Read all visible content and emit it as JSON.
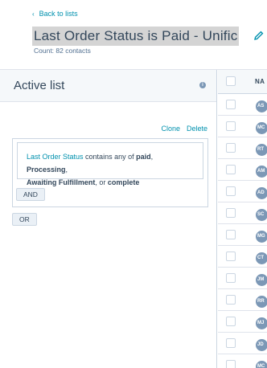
{
  "header": {
    "back_label": "Back to lists",
    "title": "Last Order Status is Paid - Unific",
    "count": "Count: 82 contacts"
  },
  "panel": {
    "title": "Active list",
    "clone_label": "Clone",
    "delete_label": "Delete",
    "filter": {
      "property": "Last Order Status",
      "operator": " contains any of ",
      "value1": "paid",
      "sep1": ", ",
      "value2": "Processing",
      "sep2": ",",
      "value3": "Awaiting Fulfillment",
      "sep3": ", or ",
      "value4": "complete"
    },
    "and_label": "AND",
    "or_label": "OR"
  },
  "table": {
    "name_header": "NA",
    "rows": [
      {
        "initials": "AS"
      },
      {
        "initials": "MC"
      },
      {
        "initials": "RT"
      },
      {
        "initials": "AM"
      },
      {
        "initials": "AD"
      },
      {
        "initials": "SC"
      },
      {
        "initials": "MG"
      },
      {
        "initials": "CT"
      },
      {
        "initials": "JM"
      },
      {
        "initials": "RR"
      },
      {
        "initials": "MJ"
      },
      {
        "initials": "JD"
      },
      {
        "initials": "MC"
      }
    ]
  },
  "colors": {
    "accent": "#0091ae",
    "text": "#33475b",
    "avatar": "#7c98b6",
    "border": "#cbd6e2"
  }
}
